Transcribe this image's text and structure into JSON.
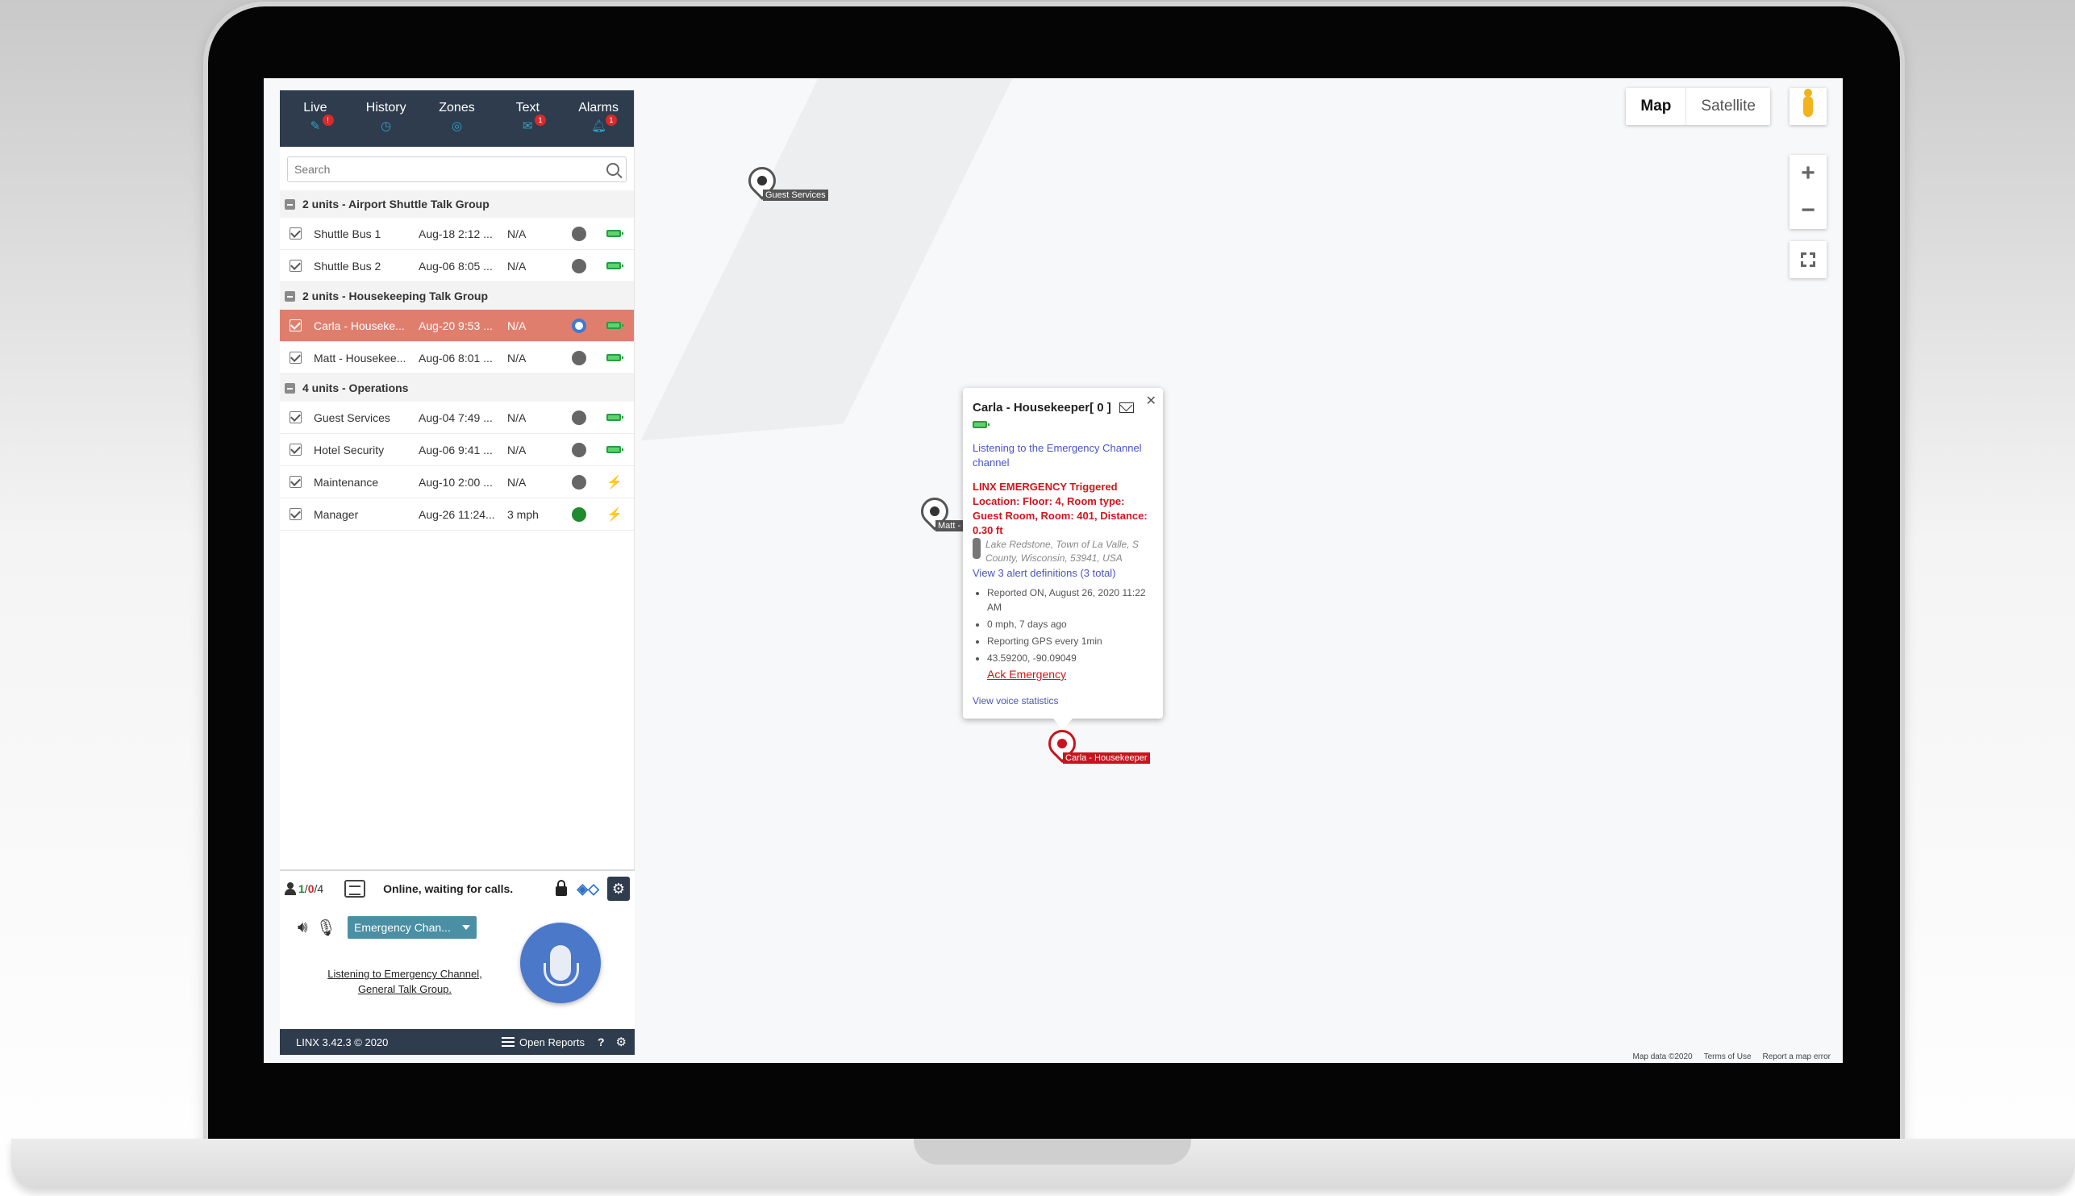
{
  "tabs": [
    {
      "label": "Live",
      "badge": "!"
    },
    {
      "label": "History",
      "badge": ""
    },
    {
      "label": "Zones",
      "badge": ""
    },
    {
      "label": "Text",
      "badge": "1"
    },
    {
      "label": "Alarms",
      "badge": "1"
    }
  ],
  "search": {
    "placeholder": "Search",
    "value": ""
  },
  "groups": [
    {
      "title": "2 units - Airport Shuttle Talk Group",
      "units": [
        {
          "name": "Shuttle Bus 1",
          "time": "Aug-18 2:12 ...",
          "speed": "N/A"
        },
        {
          "name": "Shuttle Bus 2",
          "time": "Aug-06 8:05 ...",
          "speed": "N/A"
        }
      ]
    },
    {
      "title": "2 units - Housekeeping Talk Group",
      "units": [
        {
          "name": "Carla - Houseke...",
          "time": "Aug-20 9:53 ...",
          "speed": "N/A"
        },
        {
          "name": "Matt - Housekee...",
          "time": "Aug-06 8:01 ...",
          "speed": "N/A"
        }
      ]
    },
    {
      "title": "4 units - Operations",
      "units": [
        {
          "name": "Guest Services",
          "time": "Aug-04 7:49 ...",
          "speed": "N/A"
        },
        {
          "name": "Hotel Security",
          "time": "Aug-06 9:41 ...",
          "speed": "N/A"
        },
        {
          "name": "Maintenance",
          "time": "Aug-10 2:00 ...",
          "speed": "N/A"
        },
        {
          "name": "Manager",
          "time": "Aug-26 11:24...",
          "speed": "3 mph"
        }
      ]
    }
  ],
  "status": {
    "online": "1",
    "sep1": "/",
    "alerts": "0",
    "sep2": "/",
    "total": "4",
    "text": "Online, waiting for calls."
  },
  "voice": {
    "channel": "Emergency Chan...",
    "listening_line1": "Listening to Emergency Channel,",
    "listening_line2": "General Talk Group."
  },
  "footer": {
    "version": "LINX 3.42.3  © 2020",
    "open_reports": "Open Reports",
    "help": "?"
  },
  "map": {
    "map_label": "Map",
    "satellite_label": "Satellite",
    "zoom_in": "+",
    "zoom_out": "−",
    "markers": {
      "guest": "Guest Services",
      "matt": "Matt - Housekeeper",
      "carla": "Carla - Housekeeper"
    },
    "footer": {
      "data": "Map data ©2020",
      "terms": "Terms of Use",
      "report": "Report a map error"
    }
  },
  "popup": {
    "title": "Carla - Housekeeper[ 0 ]",
    "channel": "Listening to the Emergency Channel channel",
    "alert_title": "LINX EMERGENCY Triggered",
    "alert_location": "Location: Floor: 4, Room type: Guest Room, Room: 401, Distance: 0.30 ft",
    "address": "Lake Redstone, Town of La Valle, S County, Wisconsin, 53941, USA",
    "alert_defs": "View 3 alert definitions (3 total)",
    "details": [
      "Reported ON, August 26, 2020 11:22 AM",
      "0 mph, 7 days ago",
      "Reporting GPS every 1min",
      "43.59200, -90.09049"
    ],
    "ack": "Ack Emergency",
    "voice_stats": "View voice statistics"
  },
  "colors": {
    "header_bg": "#2e3c4d",
    "alert_row": "#e07e6e",
    "emergency_red": "#d3141d",
    "link_blue": "#4a53c8",
    "channel_bg": "#4a8fa3",
    "mic_blue": "#4b78c9"
  }
}
